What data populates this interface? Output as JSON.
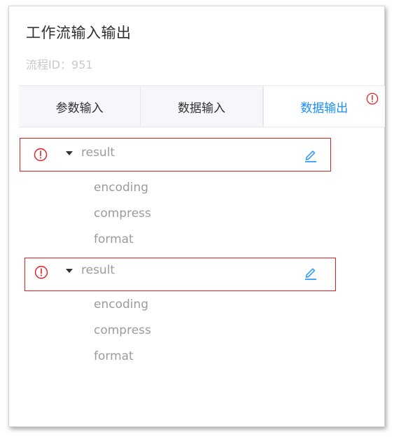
{
  "header": {
    "title": "工作流输入输出",
    "flow_id": "流程ID：951"
  },
  "tabs": [
    {
      "label": "参数输入",
      "active": false
    },
    {
      "label": "数据输入",
      "active": false
    },
    {
      "label": "数据输出",
      "active": true,
      "has_alert": true
    }
  ],
  "outputs": [
    {
      "label": "result",
      "children": [
        "encoding",
        "compress",
        "format"
      ],
      "has_error": true,
      "expanded": true
    },
    {
      "label": "result",
      "children": [
        "encoding",
        "compress",
        "format"
      ],
      "has_error": true,
      "expanded": true
    }
  ],
  "colors": {
    "accent": "#1890ff",
    "error": "#e02020",
    "muted_text": "#9a9ba0"
  },
  "icons": {
    "error": "exclamation-circle-icon",
    "expand": "caret-down-icon",
    "edit": "pencil-icon"
  }
}
